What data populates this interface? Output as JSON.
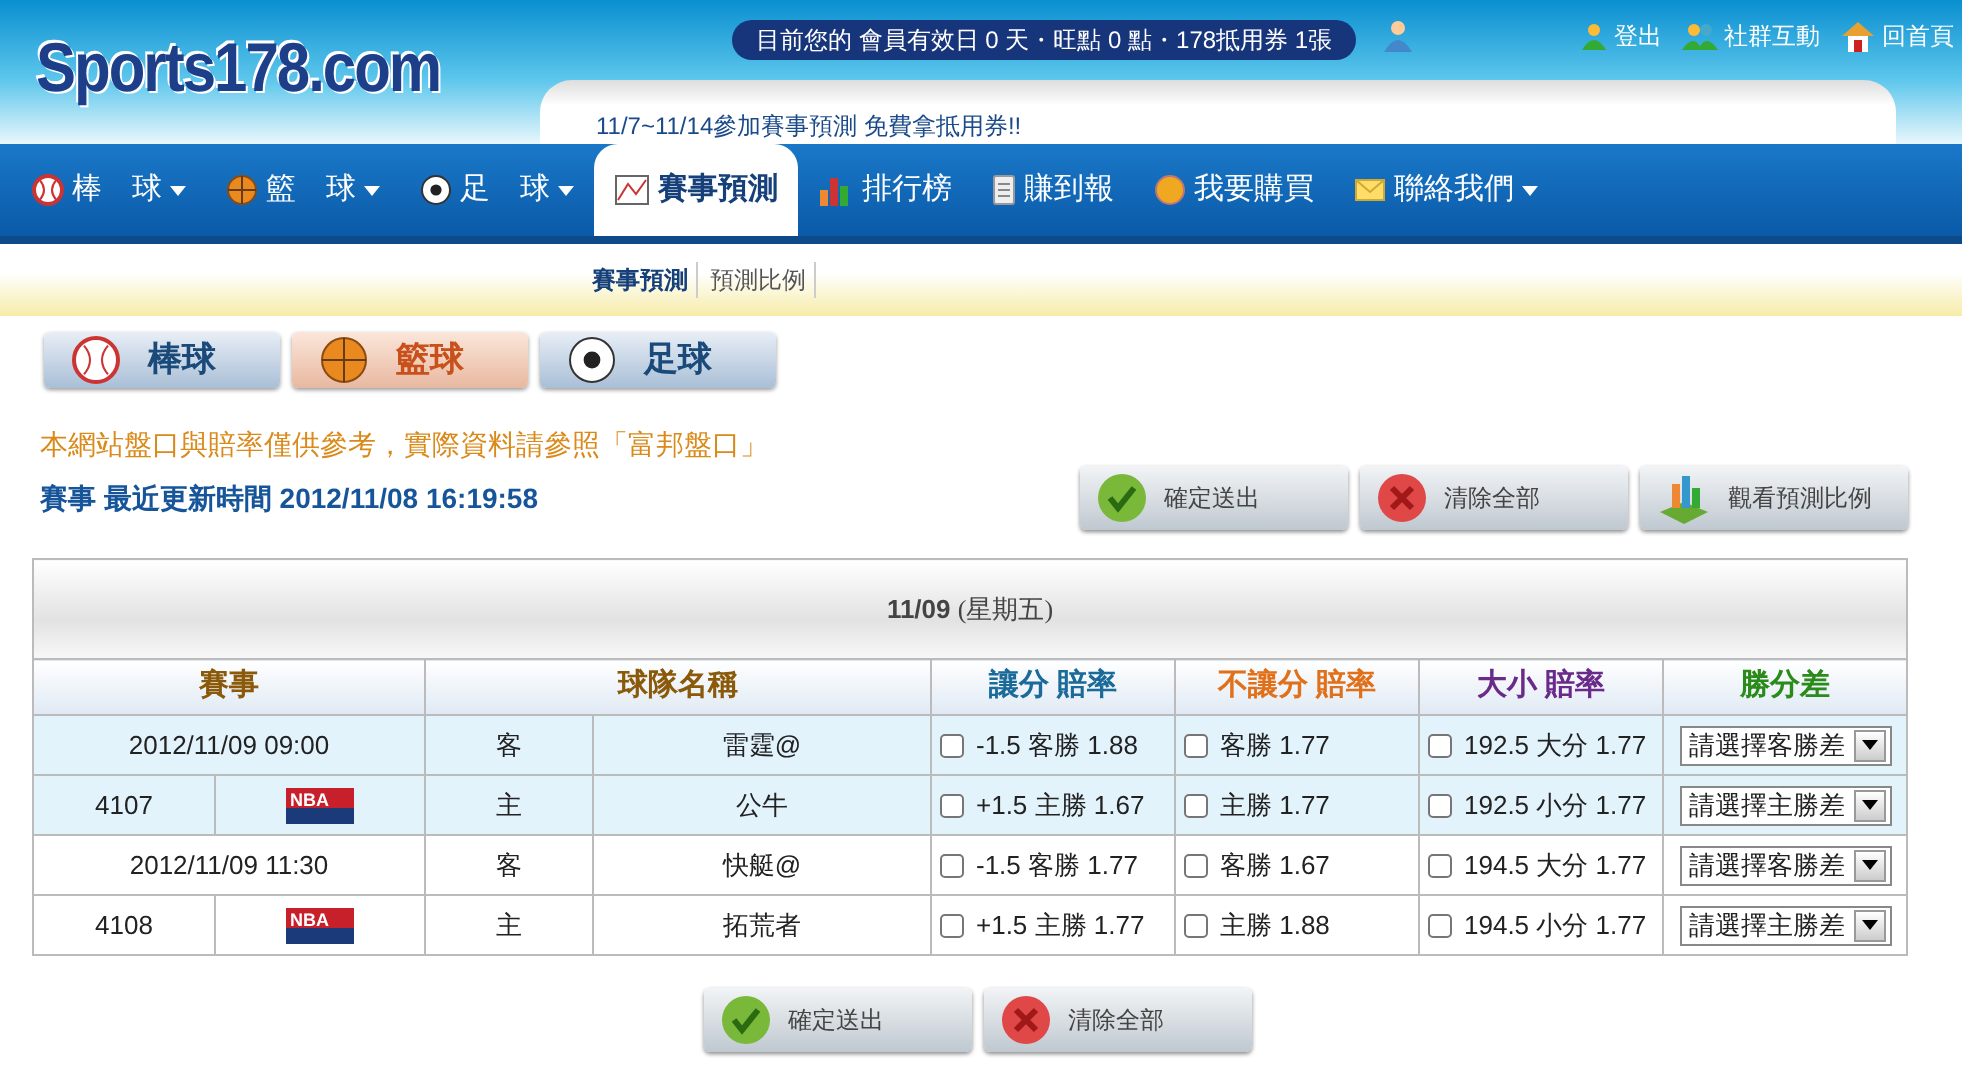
{
  "header": {
    "logo": "Sports178.com",
    "member_info": "目前您的 會員有效日 0 天・旺點 0 點・178抵用券 1張",
    "links": [
      {
        "kind": "logout",
        "label": "登出"
      },
      {
        "kind": "community",
        "label": "社群互動"
      },
      {
        "kind": "home",
        "label": "回首頁"
      }
    ],
    "announcement": "11/7~11/14參加賽事預測 免費拿抵用券!!"
  },
  "nav": [
    {
      "kind": "baseball",
      "label": "棒　球",
      "has_menu": true,
      "selected": false
    },
    {
      "kind": "basketball",
      "label": "籃　球",
      "has_menu": true,
      "selected": false
    },
    {
      "kind": "soccer",
      "label": "足　球",
      "has_menu": true,
      "selected": false
    },
    {
      "kind": "prediction",
      "label": "賽事預測",
      "has_menu": false,
      "selected": true
    },
    {
      "kind": "ranking",
      "label": "排行榜",
      "has_menu": false,
      "selected": false
    },
    {
      "kind": "report",
      "label": "賺到報",
      "has_menu": false,
      "selected": false
    },
    {
      "kind": "buy",
      "label": "我要購買",
      "has_menu": false,
      "selected": false
    },
    {
      "kind": "contact",
      "label": "聯絡我們",
      "has_menu": true,
      "selected": false
    }
  ],
  "subnav": [
    {
      "label": "賽事預測",
      "selected": true
    },
    {
      "label": "預測比例",
      "selected": false
    }
  ],
  "sport_tabs": [
    {
      "kind": "baseball",
      "label": "棒球",
      "selected": false
    },
    {
      "kind": "basketball",
      "label": "籃球",
      "selected": true
    },
    {
      "kind": "soccer",
      "label": "足球",
      "selected": false
    }
  ],
  "notice": "本網站盤口與賠率僅供參考，實際資料請參照「富邦盤口」",
  "updated": "賽事 最近更新時間 2012/11/08 16:19:58",
  "actions": [
    {
      "kind": "confirm",
      "label": "確定送出"
    },
    {
      "kind": "clear",
      "label": "清除全部"
    },
    {
      "kind": "ratio",
      "label": "觀看預測比例"
    }
  ],
  "table": {
    "date": "11/09",
    "weekday": "(星期五)",
    "columns": [
      {
        "label": "賽事",
        "color": "#8a5a0a"
      },
      {
        "label": "球隊名稱",
        "color": "#8a5a0a"
      },
      {
        "label": "讓分 賠率",
        "color": "#1a6a9a"
      },
      {
        "label": "不讓分 賠率",
        "color": "#e0701a"
      },
      {
        "label": "大小 賠率",
        "color": "#6a2a8a"
      },
      {
        "label": "勝分差",
        "color": "#2a8a1a"
      }
    ],
    "games": [
      {
        "highlighted": true,
        "time": "2012/11/09 09:00",
        "number": "4107",
        "league": "NBA",
        "teams": [
          {
            "side": "客",
            "name": "雷霆@",
            "spread": {
              "checked": false,
              "text": "-1.5 客勝 1.88"
            },
            "moneyline": {
              "checked": false,
              "text": "客勝 1.77"
            },
            "total": {
              "checked": false,
              "text": "192.5 大分 1.77"
            },
            "margin": "請選擇客勝差"
          },
          {
            "side": "主",
            "name": "公牛",
            "spread": {
              "checked": false,
              "text": "+1.5 主勝 1.67"
            },
            "moneyline": {
              "checked": false,
              "text": "主勝 1.77"
            },
            "total": {
              "checked": false,
              "text": "192.5 小分 1.77"
            },
            "margin": "請選擇主勝差"
          }
        ]
      },
      {
        "highlighted": false,
        "time": "2012/11/09 11:30",
        "number": "4108",
        "league": "NBA",
        "teams": [
          {
            "side": "客",
            "name": "快艇@",
            "spread": {
              "checked": false,
              "text": "-1.5 客勝 1.77"
            },
            "moneyline": {
              "checked": false,
              "text": "客勝 1.67"
            },
            "total": {
              "checked": false,
              "text": "194.5 大分 1.77"
            },
            "margin": "請選擇客勝差"
          },
          {
            "side": "主",
            "name": "拓荒者",
            "spread": {
              "checked": false,
              "text": "+1.5 主勝 1.77"
            },
            "moneyline": {
              "checked": false,
              "text": "主勝 1.88"
            },
            "total": {
              "checked": false,
              "text": "194.5 小分 1.77"
            },
            "margin": "請選擇主勝差"
          }
        ]
      }
    ]
  },
  "bottom_actions": [
    {
      "kind": "confirm",
      "label": "確定送出"
    },
    {
      "kind": "clear",
      "label": "清除全部"
    }
  ]
}
